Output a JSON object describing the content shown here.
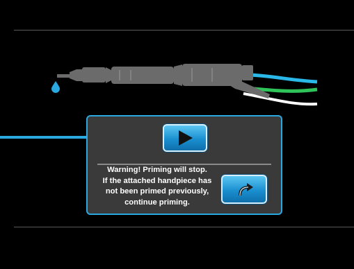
{
  "screen": {
    "background": "#000000",
    "accent_color": "#29a9e0",
    "handpiece_color": "#6b6b6b",
    "tube_colors": [
      "#29b8e8",
      "#2fc45a",
      "#ffffff"
    ],
    "drop_color": "#29a9e0"
  },
  "priming_dialog": {
    "play_button": {
      "icon": "play-icon"
    },
    "warning_lines": [
      "Warning! Priming will stop.",
      "If the attached handpiece has",
      "not been primed previously,",
      "continue priming."
    ],
    "resume_button": {
      "icon": "curved-arrow-right-icon"
    }
  },
  "annotation": {
    "pointer_color": "#29a9e0",
    "icon": "arrow-right-icon"
  }
}
